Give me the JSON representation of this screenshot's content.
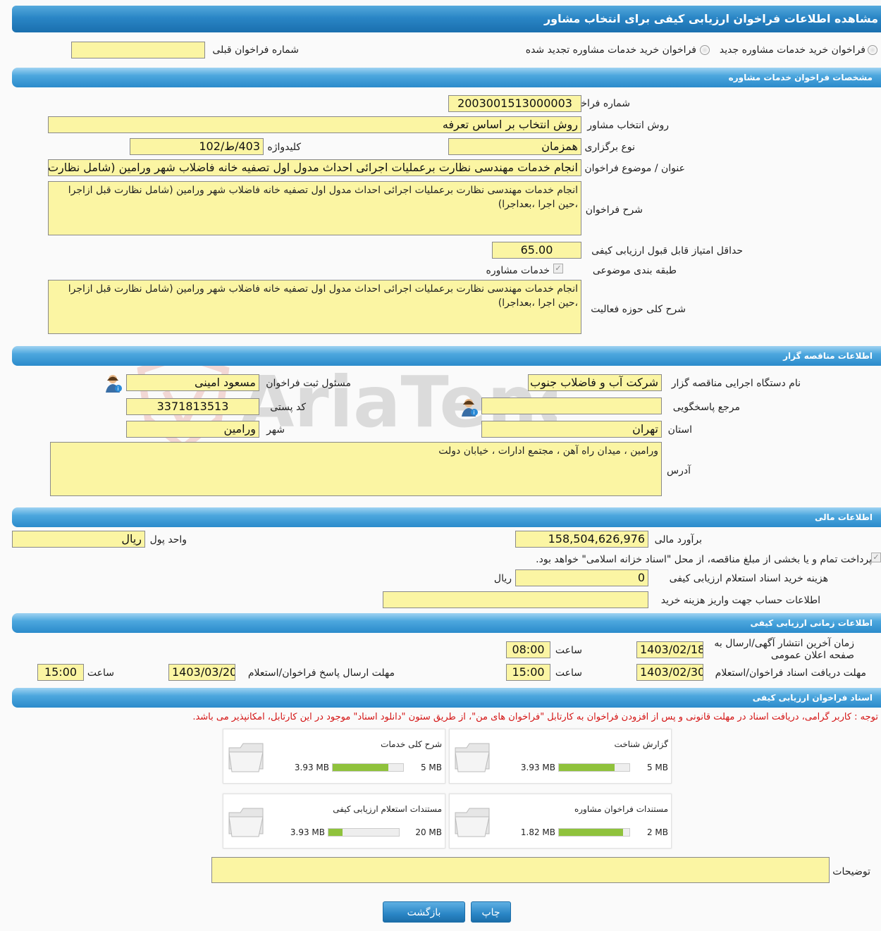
{
  "page_title": "مشاهده اطلاعات فراخوان ارزیابی کیفی برای انتخاب مشاور",
  "radios": {
    "new_label": "فراخوان خرید خدمات مشاوره جدید",
    "renewed_label": "فراخوان خرید خدمات مشاوره تجدید شده",
    "prev_number_label": "شماره فراخوان قبلی",
    "prev_number_value": ""
  },
  "sections": {
    "specs": "مشخصات فراخوان خدمات مشاوره",
    "tenderer": "اطلاعات مناقصه گزار",
    "financial": "اطلاعات مالی",
    "timing": "اطلاعات زمانی ارزیابی کیفی",
    "docs": "اسناد فراخوان ارزیابی کیفی"
  },
  "specs": {
    "number_label": "شماره فراخوان",
    "number_value": "2003001513000003",
    "method_label": "روش انتخاب مشاور",
    "method_value": "روش انتخاب بر اساس تعرفه",
    "type_label": "نوع برگزاری",
    "type_value": "همزمان",
    "keyword_label": "کلیدواژه",
    "keyword_value": "403/ط/102",
    "subject_label": "عنوان / موضوع فراخوان",
    "subject_value": "انجام خدمات مهندسی نظارت برعملیات اجرائی احداث مدول اول تصفیه خانه فاضلاب شهر ورامین (شامل نظارت",
    "desc_label": "شرح فراخوان",
    "desc_value": "انجام خدمات مهندسی نظارت برعملیات اجرائی احداث مدول اول تصفیه خانه فاضلاب شهر ورامین (شامل نظارت قبل ازاجرا ،حین اجرا ،بعداجرا)",
    "minscore_label": "حداقل امتیاز قابل قبول ارزیابی کیفی",
    "minscore_value": "65.00",
    "category_label": "طبقه بندی موضوعی",
    "category_value": "خدمات مشاوره",
    "scope_label": "شرح کلی حوزه فعالیت",
    "scope_value": "انجام خدمات مهندسی نظارت برعملیات اجرائی احداث مدول اول تصفیه خانه فاضلاب شهر ورامین (شامل نظارت قبل ازاجرا ،حین اجرا ،بعداجرا)"
  },
  "tenderer": {
    "org_label": "نام دستگاه اجرایی مناقصه گزار",
    "org_value": "شرکت آب و فاضلاب جنوب ا",
    "registrar_label": "مسئول ثبت فراخوان",
    "registrar_value": "مسعود امینی",
    "ref_label": "مرجع پاسخگویی",
    "ref_value": "",
    "postal_label": "کد پستی",
    "postal_value": "3371813513",
    "province_label": "استان",
    "province_value": "تهران",
    "city_label": "شهر",
    "city_value": "ورامین",
    "address_label": "آدرس",
    "address_value": "ورامین ، میدان راه آهن ، مجتمع ادارات ، خیابان دولت"
  },
  "financial": {
    "estimate_label": "برآورد مالی",
    "estimate_value": "158,504,626,976",
    "currency_label": "واحد پول",
    "currency_value": "ریال",
    "treasury_text": "پرداخت تمام و یا بخشی از مبلغ مناقصه، از محل \"اسناد خزانه اسلامی\" خواهد بود.",
    "fee_label": "هزینه خرید اسناد استعلام ارزیابی کیفی",
    "fee_value": "0",
    "fee_unit": "ریال",
    "account_label": "اطلاعات حساب جهت واریز هزینه خرید",
    "account_value": ""
  },
  "timing": {
    "publish_label": "زمان آخرین انتشار آگهی/ارسال به صفحه اعلان عمومی",
    "publish_date": "1403/02/18",
    "publish_time": "08:00",
    "receive_label": "مهلت دریافت اسناد فراخوان/استعلام",
    "receive_date": "1403/02/30",
    "receive_time": "15:00",
    "send_label": "مهلت ارسال پاسخ فراخوان/استعلام",
    "send_date": "1403/03/20",
    "send_time": "15:00",
    "time_label": "ساعت"
  },
  "docs": {
    "notice": "توجه : کاربر گرامی، دریافت اسناد در مهلت قانونی و پس از افزودن فراخوان به کارتابل \"فراخوان های من\"، از طریق ستون \"دانلود اسناد\" موجود در این کارتابل، امکانپذیر می باشد.",
    "cards": [
      {
        "title": "گزارش شناخت",
        "used": "3.93 MB",
        "max": "5 MB",
        "fraction": 0.786
      },
      {
        "title": "شرح کلی خدمات",
        "used": "3.93 MB",
        "max": "5 MB",
        "fraction": 0.786
      },
      {
        "title": "مستندات فراخوان مشاوره",
        "used": "1.82 MB",
        "max": "2 MB",
        "fraction": 0.91
      },
      {
        "title": "مستندات استعلام ارزیابی کیفی",
        "used": "3.93 MB",
        "max": "20 MB",
        "fraction": 0.197
      }
    ],
    "notes_label": "توضیحات",
    "notes_value": ""
  },
  "buttons": {
    "print": "چاپ",
    "back": "بازگشت"
  },
  "watermark": "AriaTender.net",
  "colors": {
    "field_bg": "#fbf5a3",
    "header_blue": "#2a86c6",
    "progress_green": "#8fc23c",
    "notice_red": "#d41414"
  }
}
